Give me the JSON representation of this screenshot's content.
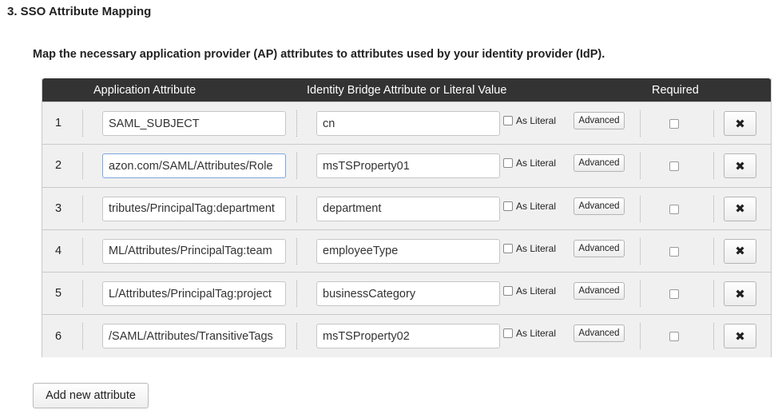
{
  "section_title": "3. SSO Attribute Mapping",
  "description": "Map the necessary application provider (AP) attributes to attributes used by your identity provider (IdP).",
  "table": {
    "headers": {
      "application_attribute": "Application Attribute",
      "identity_attribute": "Identity Bridge Attribute or Literal Value",
      "required": "Required"
    },
    "rows": [
      {
        "num": "1",
        "app_value": "SAML_SUBJECT",
        "idp_value": "cn",
        "as_literal_label": "As Literal",
        "advanced_label": "Advanced",
        "delete_icon": "✖"
      },
      {
        "num": "2",
        "app_value": "azon.com/SAML/Attributes/Role",
        "idp_value": "msTSProperty01",
        "as_literal_label": "As Literal",
        "advanced_label": "Advanced",
        "delete_icon": "✖"
      },
      {
        "num": "3",
        "app_value": "tributes/PrincipalTag:department",
        "idp_value": "department",
        "as_literal_label": "As Literal",
        "advanced_label": "Advanced",
        "delete_icon": "✖"
      },
      {
        "num": "4",
        "app_value": "ML/Attributes/PrincipalTag:team",
        "idp_value": "employeeType",
        "as_literal_label": "As Literal",
        "advanced_label": "Advanced",
        "delete_icon": "✖"
      },
      {
        "num": "5",
        "app_value": "L/Attributes/PrincipalTag:project",
        "idp_value": "businessCategory",
        "as_literal_label": "As Literal",
        "advanced_label": "Advanced",
        "delete_icon": "✖"
      },
      {
        "num": "6",
        "app_value": "/SAML/Attributes/TransitiveTags",
        "idp_value": "msTSProperty02",
        "as_literal_label": "As Literal",
        "advanced_label": "Advanced",
        "delete_icon": "✖"
      }
    ]
  },
  "add_button_label": "Add new attribute",
  "colors": {
    "header_bg": "#333333",
    "row_bg": "#f0f0f0",
    "focus_border": "#7aa7e0"
  }
}
